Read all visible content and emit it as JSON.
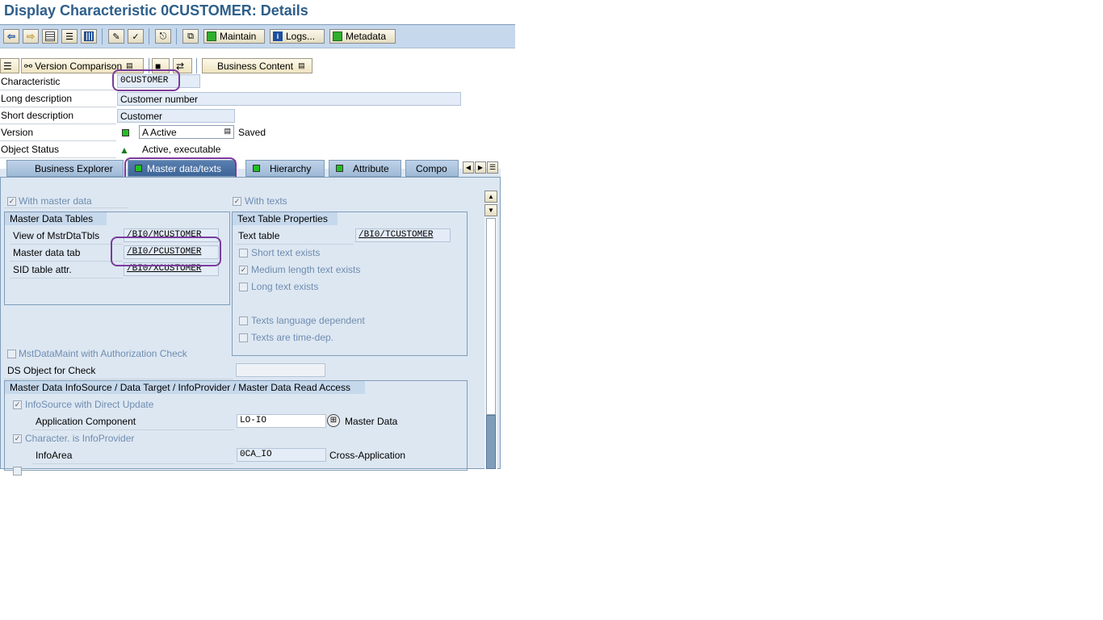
{
  "title": "Display Characteristic 0CUSTOMER: Details",
  "toolbar": {
    "maintain_label": "Maintain",
    "logs_label": "Logs...",
    "metadata_label": "Metadata"
  },
  "toolbar2": {
    "version_comparison_label": "Version Comparison",
    "business_content_label": "Business Content"
  },
  "header": {
    "characteristic_label": "Characteristic",
    "characteristic_value": "0CUSTOMER",
    "long_desc_label": "Long description",
    "long_desc_value": "Customer number",
    "short_desc_label": "Short description",
    "short_desc_value": "Customer",
    "version_label": "Version",
    "version_value": "A Active",
    "version_status": "Saved",
    "object_status_label": "Object Status",
    "object_status_value": "Active, executable"
  },
  "tabs": [
    {
      "label": "Business Explorer"
    },
    {
      "label": "Master data/texts"
    },
    {
      "label": "Hierarchy"
    },
    {
      "label": "Attribute"
    },
    {
      "label": "Compo"
    }
  ],
  "master": {
    "with_master_data": "With master data",
    "with_texts": "With texts",
    "tables_title": "Master Data Tables",
    "view_label": "View of MstrDtaTbls",
    "view_value": "/BI0/MCUSTOMER",
    "mdtab_label": "Master data tab",
    "mdtab_value": "/BI0/PCUSTOMER",
    "sid_label": "SID table attr.",
    "sid_value": "/BI0/XCUSTOMER",
    "text_props_title": "Text Table Properties",
    "text_table_label": "Text table",
    "text_table_value": "/BI0/TCUSTOMER",
    "short_text": "Short text exists",
    "medium_text": "Medium length text exists",
    "long_text": "Long text exists",
    "lang_dep": "Texts language dependent",
    "time_dep": "Texts are time-dep.",
    "auth_check": "MstDataMaint with Authorization Check",
    "ds_object_label": "DS Object for Check",
    "infosource_title": "Master Data InfoSource / Data Target / InfoProvider / Master Data Read Access",
    "infosource_direct": "InfoSource with Direct Update",
    "app_comp_label": "Application Component",
    "app_comp_value": "LO-IO",
    "app_comp_desc": "Master Data",
    "char_infoprov": "Character. is InfoProvider",
    "infoarea_label": "InfoArea",
    "infoarea_value": "0CA_IO",
    "infoarea_desc": "Cross-Application"
  }
}
